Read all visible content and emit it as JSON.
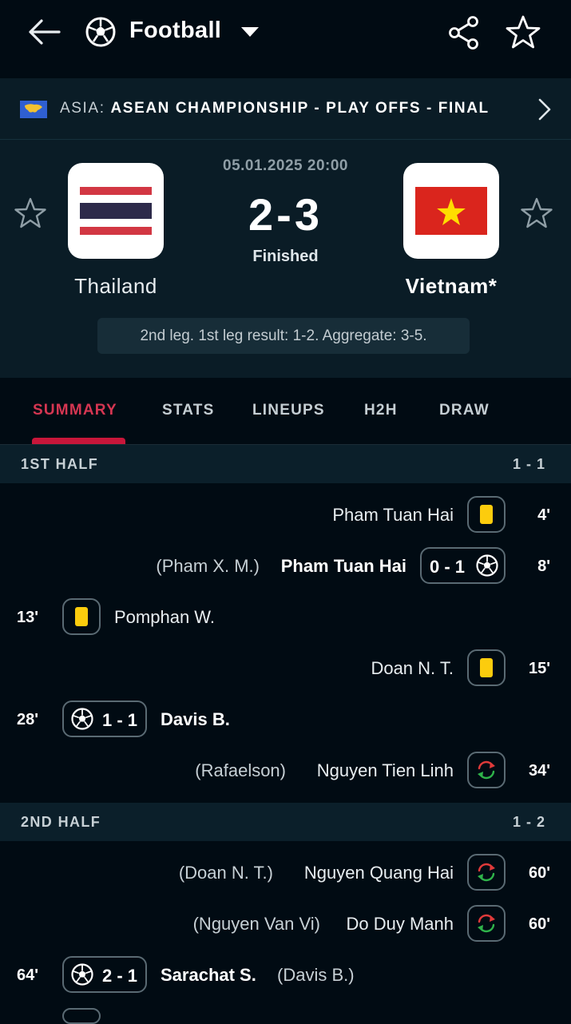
{
  "header": {
    "sport": "Football",
    "icons": {
      "back": "arrow-left-icon",
      "sport": "soccer-ball-icon",
      "dropdown": "caret-down-icon",
      "share": "share-icon",
      "favorite": "star-outline-icon"
    }
  },
  "league": {
    "country": "ASIA:",
    "name": "ASEAN CHAMPIONSHIP - PLAY OFFS - FINAL",
    "flag_icon": "asia-flag-icon",
    "chevron_icon": "chevron-right-icon"
  },
  "match": {
    "datetime": "05.01.2025 20:00",
    "score": "2-3",
    "status": "Finished",
    "home": {
      "name": "Thailand",
      "flag": "thailand-flag"
    },
    "away": {
      "name": "Vietnam*",
      "flag": "vietnam-flag"
    },
    "aggregate_note": "2nd leg. 1st leg result: 1-2. Aggregate: 3-5."
  },
  "tabs": [
    {
      "label": "SUMMARY",
      "active": true
    },
    {
      "label": "STATS"
    },
    {
      "label": "LINEUPS"
    },
    {
      "label": "H2H"
    },
    {
      "label": "DRAW"
    }
  ],
  "halves": [
    {
      "label": "1ST HALF",
      "score": "1 - 1"
    },
    {
      "label": "2ND HALF",
      "score": "1 - 2"
    }
  ],
  "events": [
    {
      "minute": "4'",
      "side": "away",
      "type": "yellow-card",
      "player": "Pham Tuan Hai"
    },
    {
      "minute": "8'",
      "side": "away",
      "type": "goal",
      "player": "Pham Tuan Hai",
      "assist": "(Pham X. M.)",
      "score": "0 - 1"
    },
    {
      "minute": "13'",
      "side": "home",
      "type": "yellow-card",
      "player": "Pomphan W."
    },
    {
      "minute": "15'",
      "side": "away",
      "type": "yellow-card",
      "player": "Doan N. T."
    },
    {
      "minute": "28'",
      "side": "home",
      "type": "goal",
      "player": "Davis B.",
      "score": "1 - 1"
    },
    {
      "minute": "34'",
      "side": "away",
      "type": "substitution",
      "player": "Nguyen Tien Linh",
      "assist": "(Rafaelson)"
    },
    {
      "minute": "60'",
      "side": "away",
      "type": "substitution",
      "player": "Nguyen Quang Hai",
      "assist": "(Doan N. T.)"
    },
    {
      "minute": "60'",
      "side": "away",
      "type": "substitution",
      "player": "Do Duy Manh",
      "assist": "(Nguyen Van Vi)"
    },
    {
      "minute": "64'",
      "side": "home",
      "type": "goal",
      "player": "Sarachat S.",
      "assist": "(Davis B.)",
      "score": "2 - 1"
    }
  ],
  "colors": {
    "background": "#010b13",
    "panel": "#0a1c26",
    "accent": "#c8163a",
    "yellow_card": "#fccc0d"
  }
}
